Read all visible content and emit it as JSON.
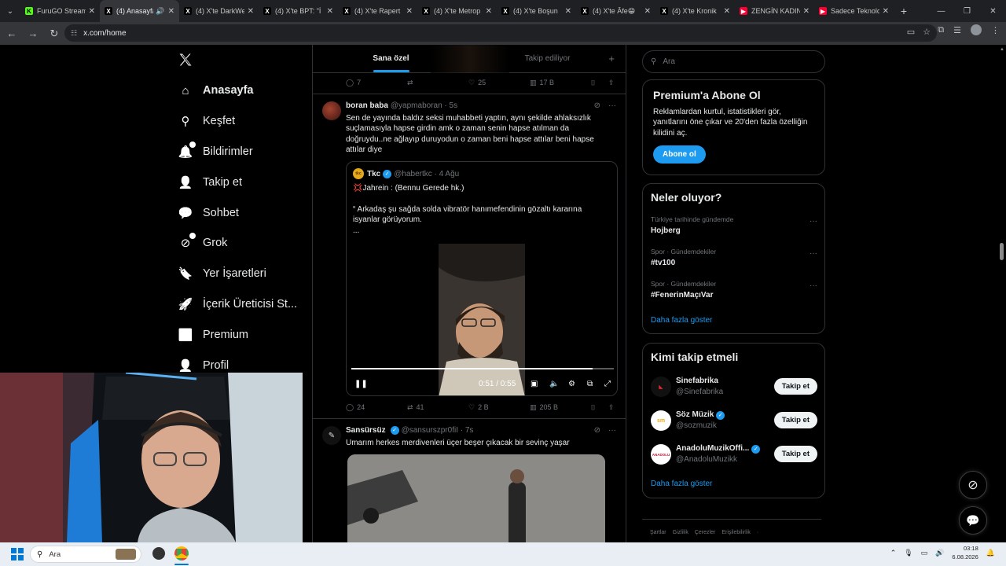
{
  "browser": {
    "tabs": [
      {
        "title": "FuruGO Stream",
        "fav_color": "#53fc18",
        "fav_char": "K",
        "active": false
      },
      {
        "title": "(4) Anasayfa",
        "fav_color": "#000000",
        "fav_char": "X",
        "active": true,
        "sound": true
      },
      {
        "title": "(4) X'te DarkWeb",
        "fav_color": "#000000",
        "fav_char": "X",
        "active": false
      },
      {
        "title": "(4) X'te BPT: \"İ",
        "fav_color": "#000000",
        "fav_char": "X",
        "active": false
      },
      {
        "title": "(4) X'te Rapert",
        "fav_color": "#000000",
        "fav_char": "X",
        "active": false
      },
      {
        "title": "(4) X'te Metrop",
        "fav_color": "#000000",
        "fav_char": "X",
        "active": false
      },
      {
        "title": "(4) X'te Boşun",
        "fav_color": "#000000",
        "fav_char": "X",
        "active": false
      },
      {
        "title": "(4) X'te Âfe😁",
        "fav_color": "#000000",
        "fav_char": "X",
        "active": false
      },
      {
        "title": "(4) X'te Kronik",
        "fav_color": "#000000",
        "fav_char": "X",
        "active": false
      },
      {
        "title": "ZENGİN KADIN",
        "fav_color": "#ff0033",
        "fav_char": "▶",
        "active": false
      },
      {
        "title": "Sadece Teknoloji",
        "fav_color": "#ff0033",
        "fav_char": "▶",
        "active": false
      }
    ],
    "url": "x.com/home"
  },
  "nav": {
    "items": [
      {
        "label": "Anasayfa",
        "icon": "home-icon",
        "glyph": "⌂",
        "active": true
      },
      {
        "label": "Keşfet",
        "icon": "search-icon",
        "glyph": "⚲",
        "active": false
      },
      {
        "label": "Bildirimler",
        "icon": "bell-icon",
        "glyph": "🔔",
        "active": false,
        "badge": "4"
      },
      {
        "label": "Takip et",
        "icon": "follow-icon",
        "glyph": "👤",
        "active": false
      },
      {
        "label": "Sohbet",
        "icon": "chat-icon",
        "glyph": "💬",
        "active": false
      },
      {
        "label": "Grok",
        "icon": "grok-icon",
        "glyph": "⊘",
        "active": false,
        "dot": true
      },
      {
        "label": "Yer İşaretleri",
        "icon": "bookmark-icon",
        "glyph": "🔖",
        "active": false
      },
      {
        "label": "İçerik Üreticisi St...",
        "icon": "rocket-icon",
        "glyph": "🚀",
        "active": false
      },
      {
        "label": "Premium",
        "icon": "premium-icon",
        "glyph": "✅",
        "active": false
      },
      {
        "label": "Profil",
        "icon": "profile-icon",
        "glyph": "👤",
        "active": false
      }
    ]
  },
  "feed": {
    "tabs": [
      "Sana özel",
      "Takip ediliyor"
    ],
    "prev_actions": {
      "replies": "7",
      "likes": "25",
      "views": "17 B"
    },
    "post1": {
      "name": "boran baba",
      "handle": "@yapmaboran · 5s",
      "text": "Sen de yayında baldız seksi muhabbeti yaptın, aynı şekilde ahlaksızlık suçlamasıyla hapse girdin amk o zaman senin hapse atılman da doğruydu..ne ağlayıp duruyodun o zaman beni hapse attılar beni hapse attılar diye",
      "quote": {
        "name": "Tkc",
        "handle": "@habertkc · 4 Ağu",
        "line1": "💢Jahrein : (Bennu Gerede hk.)",
        "line2": "“ Arkadaş şu sağda solda vibratör hanımefendinin gözaltı kararına isyanlar görüyorum.",
        "line3": "...",
        "video_time": "0:51 / 0:55",
        "progress": 0.92
      },
      "actions": {
        "replies": "24",
        "reposts": "41",
        "likes": "2 B",
        "views": "205 B"
      }
    },
    "post2": {
      "name": "Sansürsüz",
      "handle": "@sansurszpr0fiI · 7s",
      "text": "Umarım herkes merdivenleri üçer beşer çıkacak bir sevinç yaşar"
    }
  },
  "right": {
    "search_placeholder": "Ara",
    "premium": {
      "title": "Premium'a Abone Ol",
      "text": "Reklamlardan kurtul, istatistikleri gör, yanıtlarını öne çıkar ve 20'den fazla özelliğin kilidini aç.",
      "button": "Abone ol"
    },
    "trends": {
      "title": "Neler oluyor?",
      "items": [
        {
          "meta": "Türkiye tarihinde gündemde",
          "title": "Hojberg"
        },
        {
          "meta": "Spor · Gündemdekiler",
          "title": "#tv100"
        },
        {
          "meta": "Spor · Gündemdekiler",
          "title": "#FenerinMaçıVar"
        }
      ],
      "more": "Daha fazla göster"
    },
    "who_to_follow": {
      "title": "Kimi takip etmeli",
      "items": [
        {
          "name": "Sinefabrika",
          "handle": "@Sinefabrika",
          "verified": false,
          "button": "Takip et",
          "avatar_bg": "#111111",
          "avatar_fg": "#e0262f",
          "avatar_text": "◣"
        },
        {
          "name": "Söz Müzik",
          "handle": "@sozmuzik",
          "verified": true,
          "button": "Takip et",
          "avatar_bg": "#ffffff",
          "avatar_fg": "#f2a900",
          "avatar_text": "sm"
        },
        {
          "name": "AnadoluMuzikOffi...",
          "handle": "@AnadoluMuzikk",
          "verified": true,
          "button": "Takip et",
          "avatar_bg": "#ffffff",
          "avatar_fg": "#c8102e",
          "avatar_text": "ANADOLU"
        }
      ],
      "more": "Daha fazla göster"
    },
    "footer": [
      "Şartlar",
      "Gizlilik",
      "Çerezler",
      "Erişilebilirlik",
      "·"
    ]
  },
  "taskbar": {
    "search_placeholder": "Ara",
    "time": "03:18",
    "date": "6.08.2026"
  }
}
